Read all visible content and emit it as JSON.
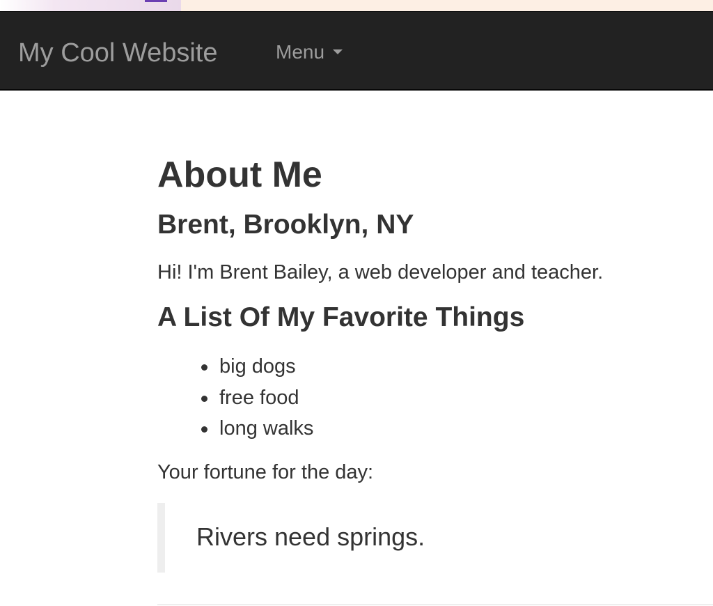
{
  "navbar": {
    "brand": "My Cool Website",
    "menu_label": "Menu",
    "menu_icon": "caret-down-icon"
  },
  "main": {
    "title": "About Me",
    "subtitle": "Brent, Brooklyn, NY",
    "intro": "Hi! I'm Brent Bailey, a web developer and teacher.",
    "list_heading": "A List Of My Favorite Things",
    "favorites": [
      "big dogs",
      "free food",
      "long walks"
    ],
    "fortune_label": "Your fortune for the day:",
    "fortune": "Rivers need springs."
  },
  "colors": {
    "navbar_bg": "#222222",
    "navbar_text": "#9d9d9d",
    "body_text": "#333333",
    "quote_border": "#eeeeee"
  }
}
